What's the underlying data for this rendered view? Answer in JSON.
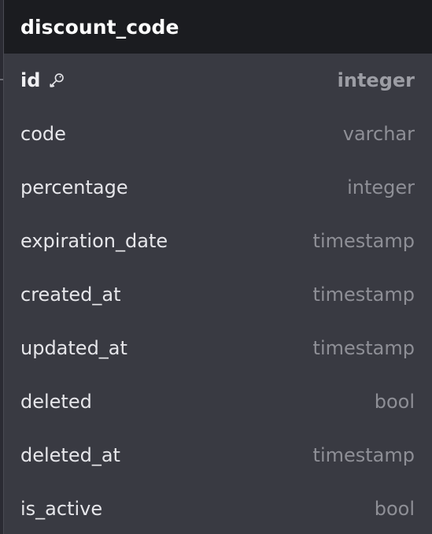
{
  "table": {
    "name": "discount_code",
    "columns": [
      {
        "name": "id",
        "type": "integer",
        "primary_key": true,
        "icon": "key-icon"
      },
      {
        "name": "code",
        "type": "varchar"
      },
      {
        "name": "percentage",
        "type": "integer"
      },
      {
        "name": "expiration_date",
        "type": "timestamp"
      },
      {
        "name": "created_at",
        "type": "timestamp"
      },
      {
        "name": "updated_at",
        "type": "timestamp"
      },
      {
        "name": "deleted",
        "type": "bool"
      },
      {
        "name": "deleted_at",
        "type": "timestamp"
      },
      {
        "name": "is_active",
        "type": "bool"
      }
    ]
  },
  "colors": {
    "header_bg": "#1b1c20",
    "body_bg": "#393a42",
    "name_text": "#e6e6ea",
    "type_text": "#8e8f96"
  }
}
